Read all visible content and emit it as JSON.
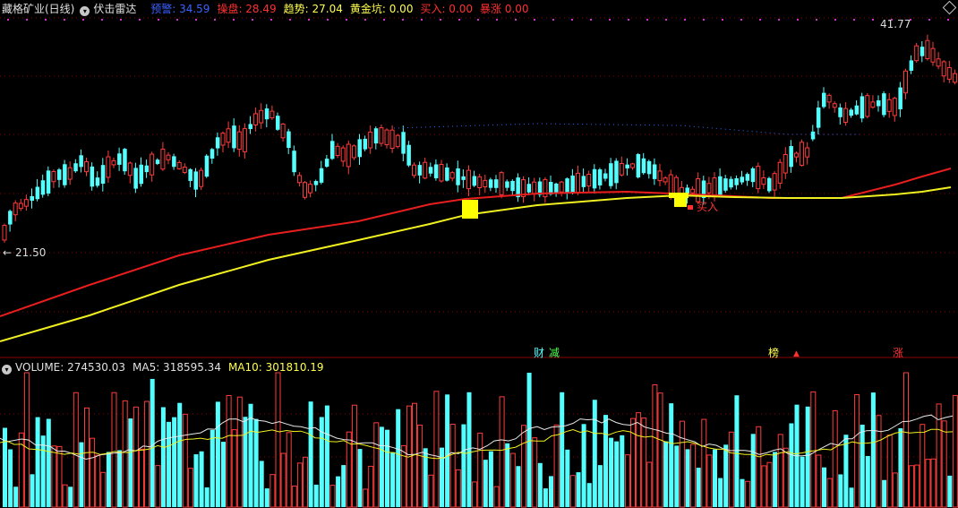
{
  "main_header": {
    "stock_name": "藏格矿业(日线)",
    "indicator_name": "伏击雷达",
    "items": [
      {
        "label": "预警:",
        "value": "34.59",
        "color": "#3a62ff"
      },
      {
        "label": "操盘:",
        "value": "28.49",
        "color": "#ff3030"
      },
      {
        "label": "趋势:",
        "value": "27.04",
        "color": "#ffff50"
      },
      {
        "label": "黄金坑:",
        "value": "0.00",
        "color": "#ffff50"
      },
      {
        "label": "买入:",
        "value": "0.00",
        "color": "#ff3030"
      },
      {
        "label": "暴涨",
        "value": "0.00",
        "color": "#ff3030"
      }
    ]
  },
  "volume_header": {
    "items": [
      {
        "label": "VOLUME:",
        "value": "274530.03",
        "color": "#e0e0e0"
      },
      {
        "label": "MA5:",
        "value": "318595.34",
        "color": "#e0e0e0"
      },
      {
        "label": "MA10:",
        "value": "301810.19",
        "color": "#ffff50"
      }
    ]
  },
  "annotations": {
    "high_label": "41.77",
    "low_label": "21.50",
    "buy_label": "买入",
    "signal_cai": "财",
    "signal_jian": "减",
    "signal_bang": "榜",
    "signal_zhang": "涨"
  },
  "colors": {
    "up": "#ff3c3c",
    "down": "#54ffff",
    "ma_red": "#e81e1e",
    "ma_yellow": "#f0f020",
    "grid": "#8b0000"
  },
  "icons": [
    "indicator-toggle-icon",
    "volume-toggle-icon",
    "expand-diamond-icon",
    "signal-triangle-icon"
  ]
}
